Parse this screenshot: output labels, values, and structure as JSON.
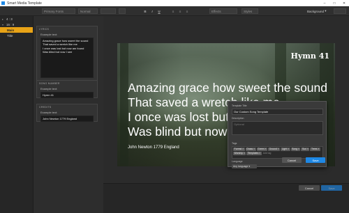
{
  "window": {
    "title": "Smart Media Template"
  },
  "toolbar": {
    "font_placeholder": "Primary Fonts",
    "weight": "Normal",
    "style_glyphs": [
      "B",
      "I",
      "U"
    ],
    "effects": "Effects",
    "styles": "Styles",
    "background": "Background"
  },
  "sidebar": {
    "items": [
      {
        "label": "4 : 3",
        "collapsed": true
      },
      {
        "label": "16 : 9",
        "collapsed": false
      },
      {
        "label": "Main",
        "active": true
      },
      {
        "label": "Title"
      }
    ]
  },
  "panels": {
    "lyrics": {
      "title": "Lyrics",
      "label": "Example text:",
      "text": "Amazing grace how sweet the sound\nThat saved a wretch like me\nI once was lost but now am found\nWas blind but now I see"
    },
    "song_number": {
      "title": "Song number",
      "label": "Example text:",
      "text": "Hymn 41"
    },
    "credits": {
      "title": "Credits",
      "label": "Example text:",
      "text": "John Newton 1779 England"
    }
  },
  "slide": {
    "title": "Hymn 41",
    "lyrics": "Amazing grace how sweet the sound\nThat saved a wretch like me\nI once was lost but now am found\nWas blind but now I see",
    "credit": "John Newton 1779 England"
  },
  "dialog": {
    "template_title_label": "Template Title",
    "template_title_value": "Our Custom Song Template",
    "description_label": "Description",
    "description_placeholder": "Optional",
    "tags_label": "Tags",
    "tags": [
      "Forrest",
      "Grass",
      "Green",
      "Ground",
      "Light",
      "Song",
      "Sun",
      "Trees",
      "Worship",
      "Templates"
    ],
    "add_tag_placeholder": "Add tag",
    "language_label": "Language",
    "language_value": "Any language",
    "cancel_label": "Cancel",
    "save_label": "Save"
  },
  "footer": {
    "cancel_label": "Cancel",
    "save_label": "Save"
  },
  "colors": {
    "accent": "#1e88e5",
    "active_item": "#e8a317"
  }
}
